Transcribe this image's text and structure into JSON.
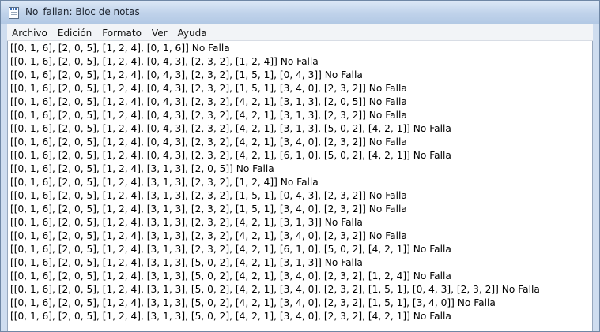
{
  "window": {
    "title": "No_fallan: Bloc de notas",
    "icon": "notepad-icon"
  },
  "menu": {
    "items": [
      {
        "label": "Archivo"
      },
      {
        "label": "Edición"
      },
      {
        "label": "Formato"
      },
      {
        "label": "Ver"
      },
      {
        "label": "Ayuda"
      }
    ]
  },
  "editor": {
    "lines": [
      "[[0, 1, 6], [2, 0, 5], [1, 2, 4], [0, 1, 6]] No Falla",
      "[[0, 1, 6], [2, 0, 5], [1, 2, 4], [0, 4, 3], [2, 3, 2], [1, 2, 4]] No Falla",
      "[[0, 1, 6], [2, 0, 5], [1, 2, 4], [0, 4, 3], [2, 3, 2], [1, 5, 1], [0, 4, 3]] No Falla",
      "[[0, 1, 6], [2, 0, 5], [1, 2, 4], [0, 4, 3], [2, 3, 2], [1, 5, 1], [3, 4, 0], [2, 3, 2]] No Falla",
      "[[0, 1, 6], [2, 0, 5], [1, 2, 4], [0, 4, 3], [2, 3, 2], [4, 2, 1], [3, 1, 3], [2, 0, 5]] No Falla",
      "[[0, 1, 6], [2, 0, 5], [1, 2, 4], [0, 4, 3], [2, 3, 2], [4, 2, 1], [3, 1, 3], [2, 3, 2]] No Falla",
      "[[0, 1, 6], [2, 0, 5], [1, 2, 4], [0, 4, 3], [2, 3, 2], [4, 2, 1], [3, 1, 3], [5, 0, 2], [4, 2, 1]] No Falla",
      "[[0, 1, 6], [2, 0, 5], [1, 2, 4], [0, 4, 3], [2, 3, 2], [4, 2, 1], [3, 4, 0], [2, 3, 2]] No Falla",
      "[[0, 1, 6], [2, 0, 5], [1, 2, 4], [0, 4, 3], [2, 3, 2], [4, 2, 1], [6, 1, 0], [5, 0, 2], [4, 2, 1]] No Falla",
      "[[0, 1, 6], [2, 0, 5], [1, 2, 4], [3, 1, 3], [2, 0, 5]] No Falla",
      "[[0, 1, 6], [2, 0, 5], [1, 2, 4], [3, 1, 3], [2, 3, 2], [1, 2, 4]] No Falla",
      "[[0, 1, 6], [2, 0, 5], [1, 2, 4], [3, 1, 3], [2, 3, 2], [1, 5, 1], [0, 4, 3], [2, 3, 2]] No Falla",
      "[[0, 1, 6], [2, 0, 5], [1, 2, 4], [3, 1, 3], [2, 3, 2], [1, 5, 1], [3, 4, 0], [2, 3, 2]] No Falla",
      "[[0, 1, 6], [2, 0, 5], [1, 2, 4], [3, 1, 3], [2, 3, 2], [4, 2, 1], [3, 1, 3]] No Falla",
      "[[0, 1, 6], [2, 0, 5], [1, 2, 4], [3, 1, 3], [2, 3, 2], [4, 2, 1], [3, 4, 0], [2, 3, 2]] No Falla",
      "[[0, 1, 6], [2, 0, 5], [1, 2, 4], [3, 1, 3], [2, 3, 2], [4, 2, 1], [6, 1, 0], [5, 0, 2], [4, 2, 1]] No Falla",
      "[[0, 1, 6], [2, 0, 5], [1, 2, 4], [3, 1, 3], [5, 0, 2], [4, 2, 1], [3, 1, 3]] No Falla",
      "[[0, 1, 6], [2, 0, 5], [1, 2, 4], [3, 1, 3], [5, 0, 2], [4, 2, 1], [3, 4, 0], [2, 3, 2], [1, 2, 4]] No Falla",
      "[[0, 1, 6], [2, 0, 5], [1, 2, 4], [3, 1, 3], [5, 0, 2], [4, 2, 1], [3, 4, 0], [2, 3, 2], [1, 5, 1], [0, 4, 3], [2, 3, 2]] No Falla",
      "[[0, 1, 6], [2, 0, 5], [1, 2, 4], [3, 1, 3], [5, 0, 2], [4, 2, 1], [3, 4, 0], [2, 3, 2], [1, 5, 1], [3, 4, 0]] No Falla",
      "[[0, 1, 6], [2, 0, 5], [1, 2, 4], [3, 1, 3], [5, 0, 2], [4, 2, 1], [3, 4, 0], [2, 3, 2], [4, 2, 1]] No Falla"
    ]
  }
}
